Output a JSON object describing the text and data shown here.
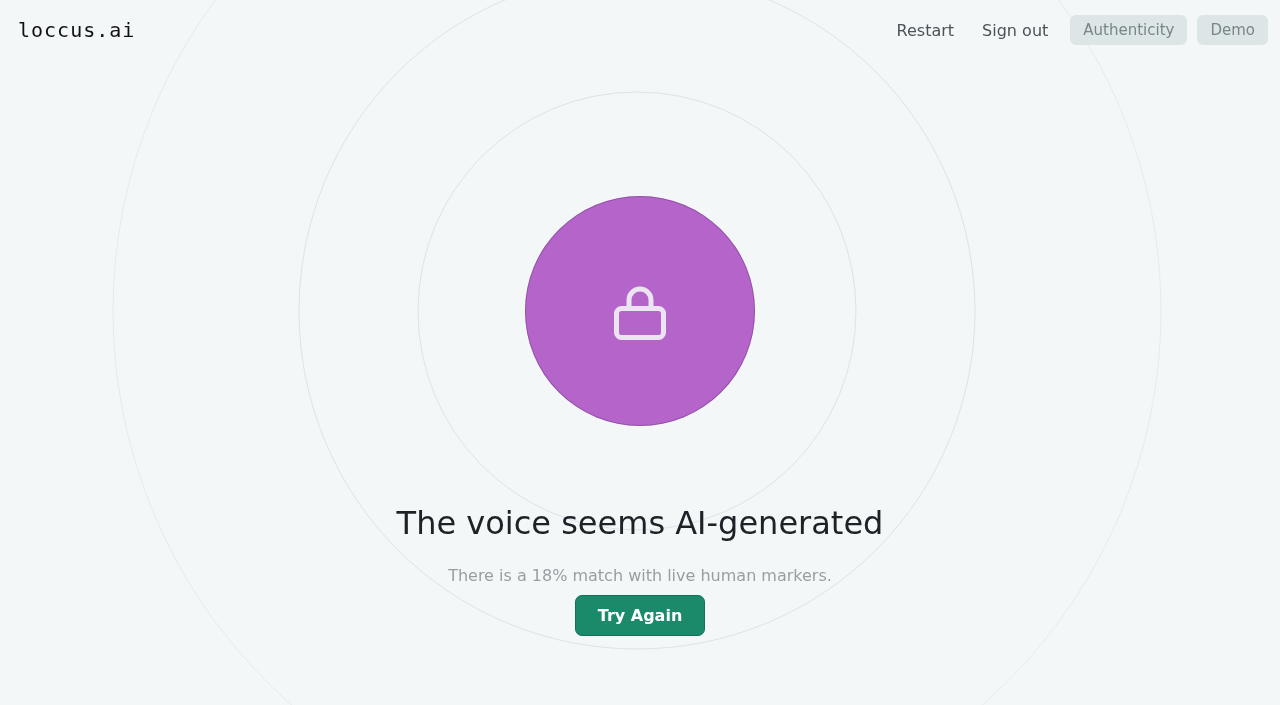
{
  "header": {
    "logo": "loccus.ai",
    "nav": [
      {
        "label": "Restart",
        "kind": "link"
      },
      {
        "label": "Sign out",
        "kind": "link"
      },
      {
        "label": "Authenticity",
        "kind": "pill"
      },
      {
        "label": "Demo",
        "kind": "pill"
      }
    ]
  },
  "result": {
    "color": "#b565c9",
    "title": "The voice seems AI-generated",
    "message": "There is a 18% match with live human markers.",
    "button": "Try Again"
  }
}
